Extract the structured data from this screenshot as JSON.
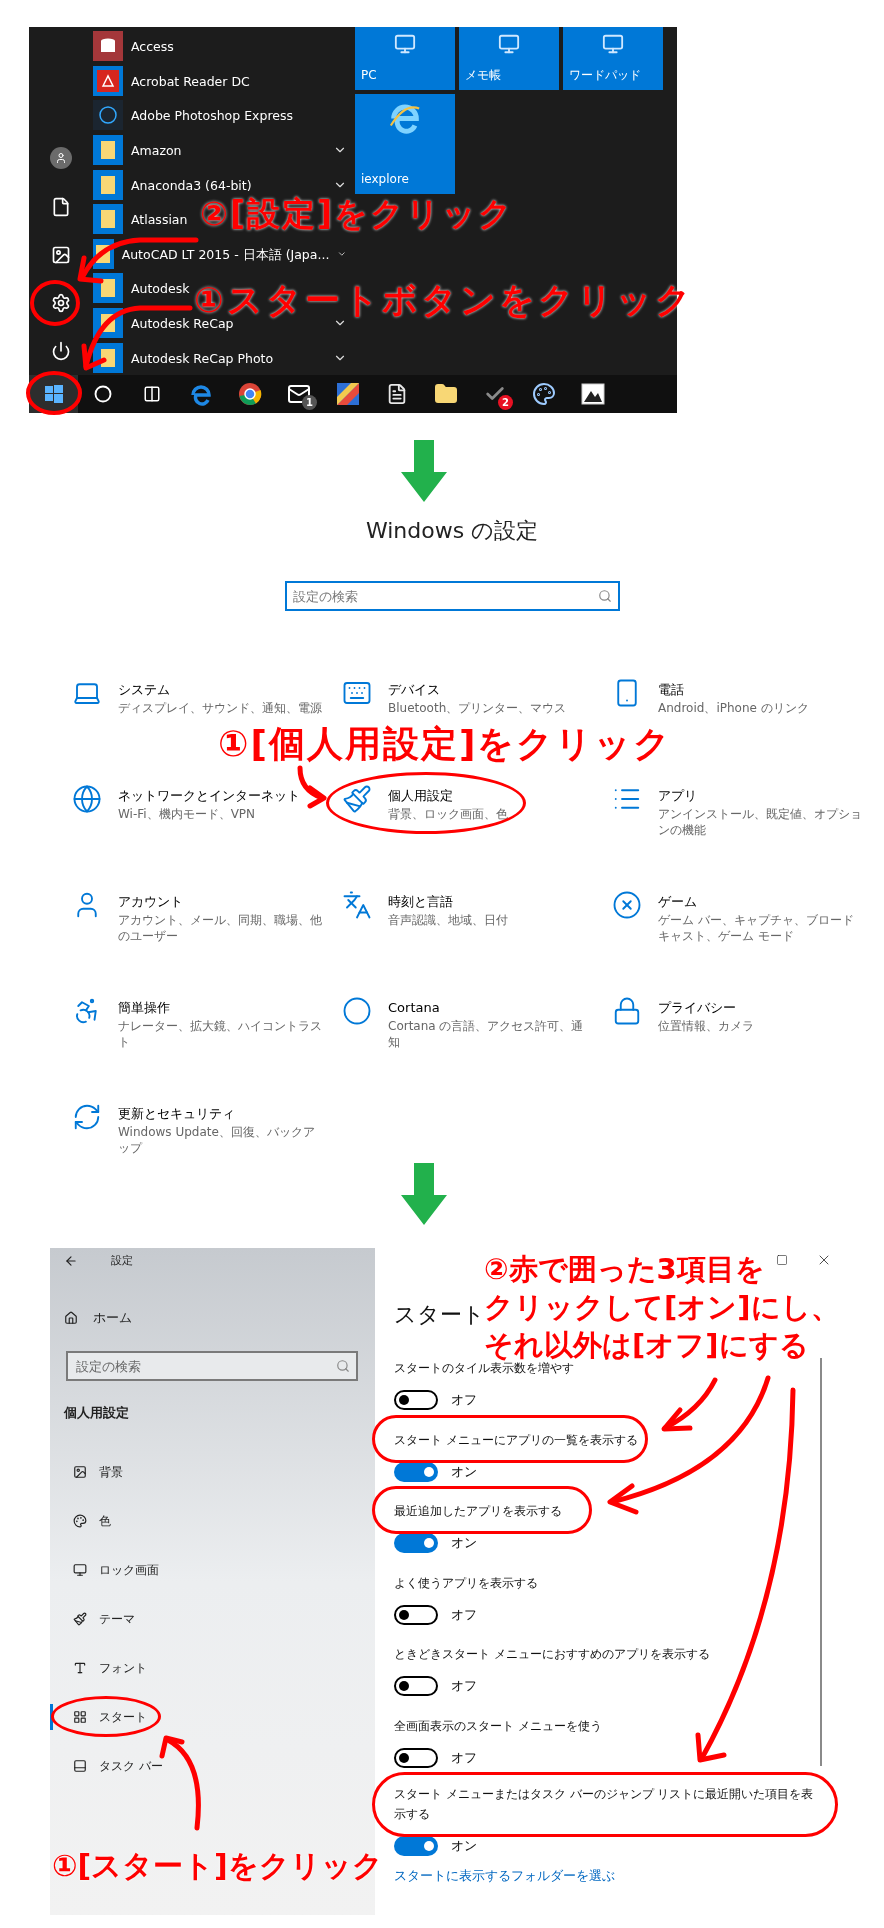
{
  "start_menu": {
    "apps": [
      {
        "name": "Access",
        "expandable": false
      },
      {
        "name": "Acrobat Reader DC",
        "expandable": false
      },
      {
        "name": "Adobe Photoshop Express",
        "expandable": false
      },
      {
        "name": "Amazon",
        "expandable": true
      },
      {
        "name": "Anaconda3 (64-bit)",
        "expandable": true
      },
      {
        "name": "Atlassian",
        "expandable": false
      },
      {
        "name": "AutoCAD LT 2015 - 日本語 (Japa...",
        "expandable": true
      },
      {
        "name": "Autodesk",
        "expandable": false
      },
      {
        "name": "Autodesk ReCap",
        "expandable": true
      },
      {
        "name": "Autodesk ReCap Photo",
        "expandable": true
      }
    ],
    "tiles": [
      {
        "label": "PC"
      },
      {
        "label": "メモ帳"
      },
      {
        "label": "ワードパッド"
      },
      {
        "label": "iexplore"
      }
    ],
    "taskbar": [
      {
        "kind": "start"
      },
      {
        "kind": "search"
      },
      {
        "kind": "taskview"
      },
      {
        "kind": "edge"
      },
      {
        "kind": "chrome"
      },
      {
        "kind": "mail",
        "badge": "1"
      },
      {
        "kind": "colors"
      },
      {
        "kind": "notepad"
      },
      {
        "kind": "explorer"
      },
      {
        "kind": "check",
        "badge": "2"
      },
      {
        "kind": "paint"
      },
      {
        "kind": "photos"
      }
    ],
    "annotations": [
      "②[設定]をクリック",
      "①スタートボタンをクリック"
    ]
  },
  "settings_home": {
    "title": "Windows の設定",
    "search": {
      "placeholder": "設定の検索"
    },
    "categories": [
      {
        "title": "システム",
        "subtitle": "ディスプレイ、サウンド、通知、電源",
        "circled": false
      },
      {
        "title": "デバイス",
        "subtitle": "Bluetooth、プリンター、マウス",
        "circled": false
      },
      {
        "title": "電話",
        "subtitle": "Android、iPhone のリンク",
        "circled": false
      },
      {
        "title": "ネットワークとインターネット",
        "subtitle": "Wi-Fi、機内モード、VPN",
        "circled": false
      },
      {
        "title": "個人用設定",
        "subtitle": "背景、ロック画面、色",
        "circled": true
      },
      {
        "title": "アプリ",
        "subtitle": "アンインストール、既定値、オプションの機能",
        "circled": false
      },
      {
        "title": "アカウント",
        "subtitle": "アカウント、メール、同期、職場、他のユーザー",
        "circled": false
      },
      {
        "title": "時刻と言語",
        "subtitle": "音声認識、地域、日付",
        "circled": false
      },
      {
        "title": "ゲーム",
        "subtitle": "ゲーム バー、キャプチャ、ブロードキャスト、ゲーム モード",
        "circled": false
      },
      {
        "title": "簡単操作",
        "subtitle": "ナレーター、拡大鏡、ハイコントラスト",
        "circled": false
      },
      {
        "title": "Cortana",
        "subtitle": "Cortana の言語、アクセス許可、通知",
        "circled": false
      },
      {
        "title": "プライバシー",
        "subtitle": "位置情報、カメラ",
        "circled": false
      },
      {
        "title": "更新とセキュリティ",
        "subtitle": "Windows Update、回復、バックアップ",
        "circled": false
      }
    ],
    "annotation": "①[個人用設定]をクリック"
  },
  "personalization": {
    "window_title": "設定",
    "home": "ホーム",
    "search": {
      "placeholder": "設定の検索"
    },
    "section": "個人用設定",
    "nav": [
      {
        "label": "背景",
        "selected": false,
        "circled": false
      },
      {
        "label": "色",
        "selected": false,
        "circled": false
      },
      {
        "label": "ロック画面",
        "selected": false,
        "circled": false
      },
      {
        "label": "テーマ",
        "selected": false,
        "circled": false
      },
      {
        "label": "フォント",
        "selected": false,
        "circled": false
      },
      {
        "label": "スタート",
        "selected": true,
        "circled": true
      },
      {
        "label": "タスク バー",
        "selected": false,
        "circled": false
      }
    ],
    "heading": "スタート",
    "settings": [
      {
        "label": "スタートのタイル表示数を増やす",
        "on": false,
        "state_text": "オフ",
        "circled": false
      },
      {
        "label": "スタート メニューにアプリの一覧を表示する",
        "on": true,
        "state_text": "オン",
        "circled": true
      },
      {
        "label": "最近追加したアプリを表示する",
        "on": true,
        "state_text": "オン",
        "circled": true
      },
      {
        "label": "よく使うアプリを表示する",
        "on": false,
        "state_text": "オフ",
        "circled": false
      },
      {
        "label": "ときどきスタート メニューにおすすめのアプリを表示する",
        "on": false,
        "state_text": "オフ",
        "circled": false
      },
      {
        "label": "全画面表示のスタート メニューを使う",
        "on": false,
        "state_text": "オフ",
        "circled": false
      },
      {
        "label": "スタート メニューまたはタスク バーのジャンプ リストに最近開いた項目を表示する",
        "on": true,
        "state_text": "オン",
        "circled": true
      }
    ],
    "link": "スタートに表示するフォルダーを選ぶ",
    "annotations": {
      "nav": "①[スタート]をクリック",
      "toggles": [
        "②赤で囲った3項目を",
        "クリックして[オン]にし、",
        "それ以外は[オフ]にする"
      ]
    }
  }
}
